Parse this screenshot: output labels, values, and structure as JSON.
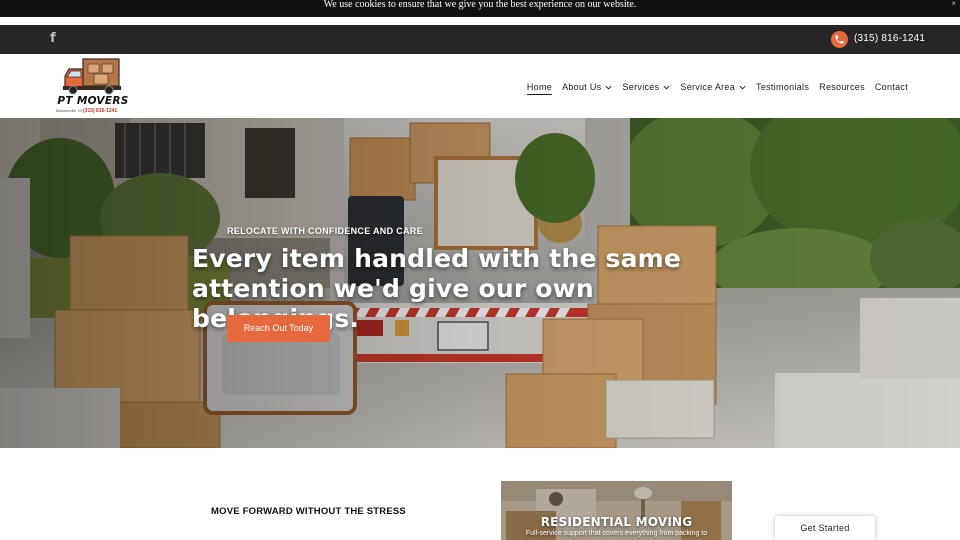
{
  "cookie_bar": {
    "text": "We use cookies to ensure that we give you the best experience on our website.",
    "close": "×"
  },
  "top_bar": {
    "social_icon": "facebook-icon",
    "phone": "(315) 816-1241",
    "phone_icon": "phone-icon"
  },
  "logo": {
    "name": "PT MOVERS",
    "phone": "(315) 816-1241",
    "tagline": "Baldwinsville, NY"
  },
  "nav": {
    "items": [
      {
        "label": "Home",
        "active": true,
        "dropdown": false
      },
      {
        "label": "About Us",
        "active": false,
        "dropdown": true
      },
      {
        "label": "Services",
        "active": false,
        "dropdown": true
      },
      {
        "label": "Service Area",
        "active": false,
        "dropdown": true
      },
      {
        "label": "Testimonials",
        "active": false,
        "dropdown": false
      },
      {
        "label": "Resources",
        "active": false,
        "dropdown": false
      },
      {
        "label": "Contact",
        "active": false,
        "dropdown": false
      }
    ]
  },
  "hero": {
    "eyebrow": "RELOCATE WITH CONFIDENCE AND CARE",
    "heading": "Every item handled with the same attention we'd give our own belongings.",
    "button": "Reach Out Today"
  },
  "section": {
    "tagline": "MOVE FORWARD WITHOUT THE STRESS",
    "card": {
      "title": "RESIDENTIAL MOVING",
      "description": "Full-service support that covers everything from packing to"
    }
  },
  "floating": {
    "get_started": "Get Started"
  },
  "colors": {
    "accent": "#e8683d",
    "top_bar": "#262626",
    "cookie_bar": "#111111"
  }
}
